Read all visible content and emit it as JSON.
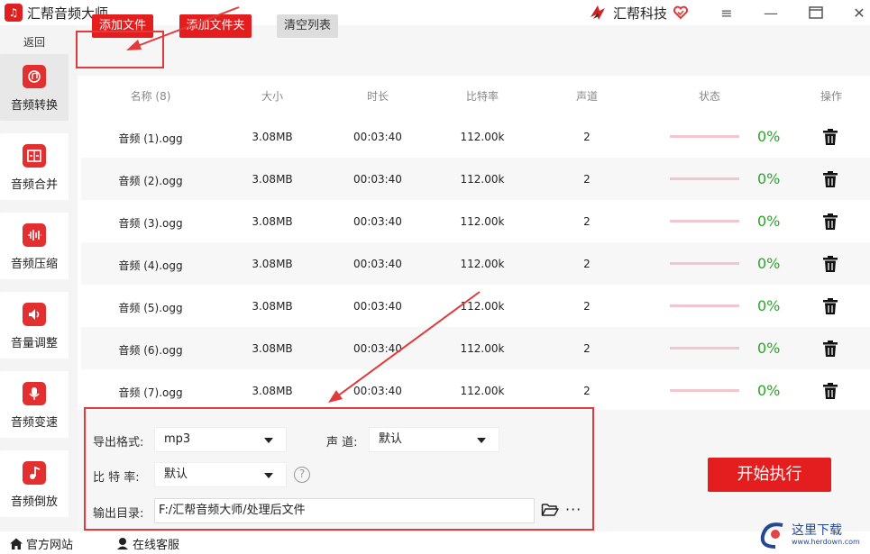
{
  "app": {
    "title": "汇帮音频大师",
    "brand": "汇帮科技"
  },
  "sidebar": {
    "back": "返回",
    "items": [
      {
        "label": "音频转换",
        "icon": "audio-convert-icon",
        "active": true
      },
      {
        "label": "音频合并",
        "icon": "audio-merge-icon"
      },
      {
        "label": "音频压缩",
        "icon": "audio-compress-icon"
      },
      {
        "label": "音量调整",
        "icon": "volume-adjust-icon"
      },
      {
        "label": "音频变速",
        "icon": "audio-speed-icon"
      },
      {
        "label": "音频倒放",
        "icon": "audio-reverse-icon"
      }
    ]
  },
  "toolbar": {
    "add_file": "添加文件",
    "add_folder": "添加文件夹",
    "clear_list": "清空列表"
  },
  "table": {
    "headers": {
      "name": "名称 (8)",
      "size": "大小",
      "duration": "时长",
      "bitrate": "比特率",
      "channels": "声道",
      "status": "状态",
      "action": "操作"
    },
    "rows": [
      {
        "name": "音频 (1).ogg",
        "size": "3.08MB",
        "duration": "00:03:40",
        "bitrate": "112.00k",
        "channels": "2",
        "progress": "0%"
      },
      {
        "name": "音频 (2).ogg",
        "size": "3.08MB",
        "duration": "00:03:40",
        "bitrate": "112.00k",
        "channels": "2",
        "progress": "0%"
      },
      {
        "name": "音频 (3).ogg",
        "size": "3.08MB",
        "duration": "00:03:40",
        "bitrate": "112.00k",
        "channels": "2",
        "progress": "0%"
      },
      {
        "name": "音频 (4).ogg",
        "size": "3.08MB",
        "duration": "00:03:40",
        "bitrate": "112.00k",
        "channels": "2",
        "progress": "0%"
      },
      {
        "name": "音频 (5).ogg",
        "size": "3.08MB",
        "duration": "00:03:40",
        "bitrate": "112.00k",
        "channels": "2",
        "progress": "0%"
      },
      {
        "name": "音频 (6).ogg",
        "size": "3.08MB",
        "duration": "00:03:40",
        "bitrate": "112.00k",
        "channels": "2",
        "progress": "0%"
      },
      {
        "name": "音频 (7).ogg",
        "size": "3.08MB",
        "duration": "00:03:40",
        "bitrate": "112.00k",
        "channels": "2",
        "progress": "0%"
      }
    ]
  },
  "settings": {
    "format_label": "导出格式:",
    "format_value": "mp3",
    "channel_label": "声 道:",
    "channel_value": "默认",
    "bitrate_label": "比 特 率:",
    "bitrate_value": "默认",
    "help": "?",
    "output_label": "输出目录:",
    "output_value": "F:/汇帮音频大师/处理后文件",
    "more": "···"
  },
  "start_button": "开始执行",
  "footer": {
    "website": "官方网站",
    "support": "在线客服"
  },
  "watermark": {
    "text": "这里下载",
    "url": "www.herdown.com"
  },
  "colors": {
    "accent": "#e41e1e",
    "highlight": "#e23a3a",
    "progress_text": "#2aa62a"
  }
}
